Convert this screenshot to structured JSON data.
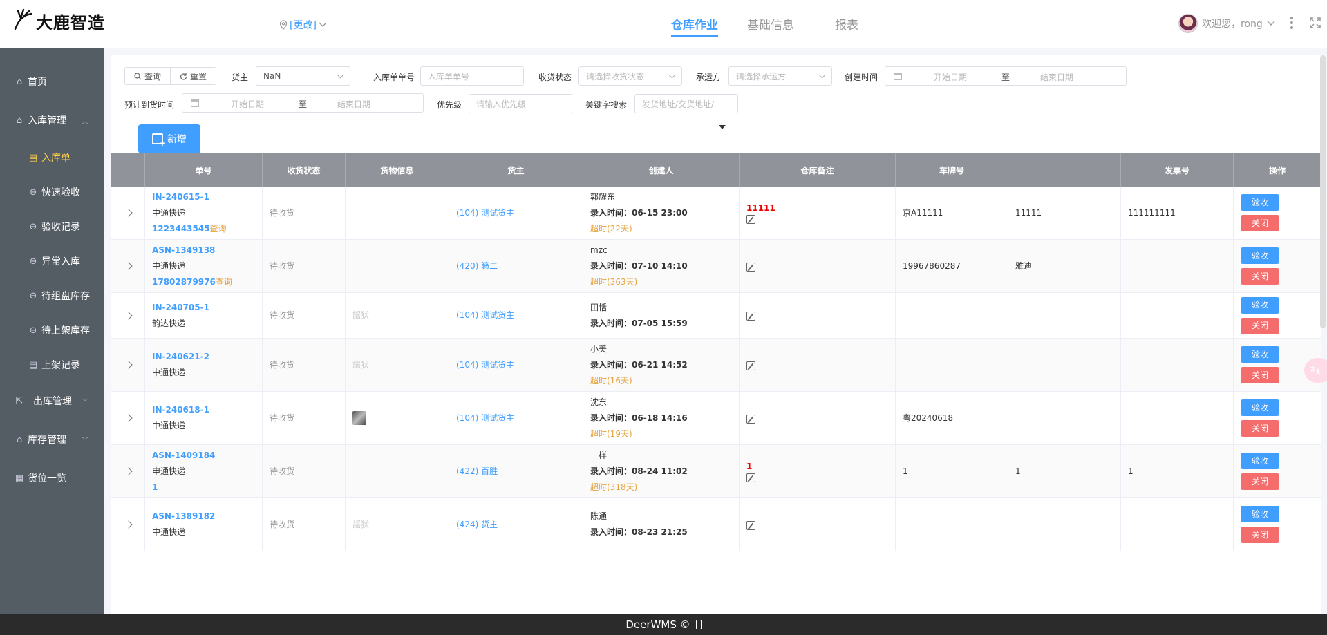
{
  "header": {
    "logo_text": "大鹿智造",
    "location_link": "[更改]",
    "tabs": [
      {
        "label": "仓库作业",
        "active": true
      },
      {
        "label": "基础信息",
        "active": false
      },
      {
        "label": "报表",
        "active": false
      }
    ],
    "user_greeting": "欢迎您，rong"
  },
  "sidebar": {
    "items": [
      {
        "label": "首页",
        "icon": "home-icon",
        "level": 0
      },
      {
        "label": "入库管理",
        "icon": "inbound-icon",
        "level": 0,
        "expanded": true
      },
      {
        "label": "入库单",
        "icon": "doc-icon",
        "level": 1,
        "active": true
      },
      {
        "label": "快速验收",
        "icon": "circle-dots-icon",
        "level": 1
      },
      {
        "label": "验收记录",
        "icon": "circle-dots-icon",
        "level": 1
      },
      {
        "label": "异常入库",
        "icon": "circle-dots-icon",
        "level": 1
      },
      {
        "label": "待组盘库存",
        "icon": "circle-dots-icon",
        "level": 1
      },
      {
        "label": "待上架库存",
        "icon": "circle-dots-icon",
        "level": 1
      },
      {
        "label": "上架记录",
        "icon": "doc-icon",
        "level": 1
      },
      {
        "label": "出库管理",
        "icon": "outbound-icon",
        "level": 0
      },
      {
        "label": "库存管理",
        "icon": "inventory-icon",
        "level": 0
      },
      {
        "label": "货位一览",
        "icon": "grid-icon",
        "level": 0
      }
    ]
  },
  "filter": {
    "query_label": "查询",
    "reset_label": "重置",
    "owner_label": "货主",
    "owner_value": "NaN",
    "order_no_label": "入库单单号",
    "order_no_placeholder": "入库单单号",
    "receive_status_label": "收货状态",
    "receive_status_placeholder": "请选择收货状态",
    "carrier_label": "承运方",
    "carrier_placeholder": "请选择承运方",
    "create_time_label": "创建时间",
    "start_date": "开始日期",
    "range_sep": "至",
    "end_date": "结束日期",
    "eta_label": "预计到货时间",
    "priority_label": "优先级",
    "priority_placeholder": "请输入优先级",
    "keyword_label": "关键字搜索",
    "keyword_placeholder": "发货地址/交货地址/",
    "add_label": "新增"
  },
  "table": {
    "columns": [
      "单号",
      "收货状态",
      "货物信息",
      "货主",
      "创建人",
      "仓库备注",
      "车牌号",
      "",
      "发票号",
      "操作"
    ],
    "rows": [
      {
        "order_no": "IN-240615-1",
        "carrier": "中通快递",
        "tracking": "1223443545",
        "query": "查询",
        "status": "待收货",
        "goods": "",
        "thumb": false,
        "owner": "(104)  测试货主",
        "creator": "郭耀东",
        "entry_time": "录入时间：06-15 23:00",
        "overdue": "超时(22天)",
        "remark": "11111",
        "plate": "京A11111",
        "col8": "11111",
        "invoice": "111111111"
      },
      {
        "order_no": "ASN-1349138",
        "carrier": "中通快递",
        "tracking": "17802879976",
        "query": "查询",
        "status": "待收货",
        "goods": "",
        "thumb": false,
        "owner": "(420)  籁二",
        "creator": "mzc",
        "entry_time": "录入时间：07-10 14:10",
        "overdue": "超时(363天)",
        "remark": "",
        "plate": "19967860287",
        "col8": "雅迪",
        "invoice": ""
      },
      {
        "order_no": "IN-240705-1",
        "carrier": "韵达快递",
        "tracking": "",
        "query": "",
        "status": "待收货",
        "goods": "謡犾",
        "thumb": false,
        "owner": "(104)  测试货主",
        "creator": "田恬",
        "entry_time": "录入时间：07-05 15:59",
        "overdue": "",
        "remark": "",
        "plate": "",
        "col8": "",
        "invoice": ""
      },
      {
        "order_no": "IN-240621-2",
        "carrier": "中通快递",
        "tracking": "",
        "query": "",
        "status": "待收货",
        "goods": "謡犾",
        "thumb": false,
        "owner": "(104)  测试货主",
        "creator": "小美",
        "entry_time": "录入时间：06-21 14:52",
        "overdue": "超时(16天)",
        "remark": "",
        "plate": "",
        "col8": "",
        "invoice": ""
      },
      {
        "order_no": "IN-240618-1",
        "carrier": "中通快递",
        "tracking": "",
        "query": "",
        "status": "待收货",
        "goods": "",
        "thumb": true,
        "owner": "(104)  测试货主",
        "creator": "沈东",
        "entry_time": "录入时间：06-18 14:16",
        "overdue": "超时(19天)",
        "remark": "",
        "plate": "粤20240618",
        "col8": "",
        "invoice": ""
      },
      {
        "order_no": "ASN-1409184",
        "carrier": "申通快递",
        "tracking": "1",
        "query": "",
        "status": "待收货",
        "goods": "",
        "thumb": false,
        "owner": "(422)  百胜",
        "creator": "一样",
        "entry_time": "录入时间：08-24 11:02",
        "overdue": "超时(318天)",
        "remark": "1",
        "plate": "1",
        "col8": "1",
        "invoice": "1"
      },
      {
        "order_no": "ASN-1389182",
        "carrier": "中通快递",
        "tracking": "",
        "query": "",
        "status": "待收货",
        "goods": "謡犾",
        "thumb": false,
        "owner": "(424)  货主",
        "creator": "陈通",
        "entry_time": "录入时间：08-23 21:25",
        "overdue": "",
        "remark": "",
        "plate": "",
        "col8": "",
        "invoice": ""
      }
    ],
    "accept_label": "验收",
    "close_label": "关闭"
  },
  "footer": {
    "text": "DeerWMS  ©"
  },
  "colors": {
    "primary": "#409eff",
    "danger": "#f56c6c",
    "warning": "#e6a23c",
    "sidebar_bg": "#545c64",
    "sidebar_active": "#ffd04b",
    "header_row_bg": "#909399"
  }
}
